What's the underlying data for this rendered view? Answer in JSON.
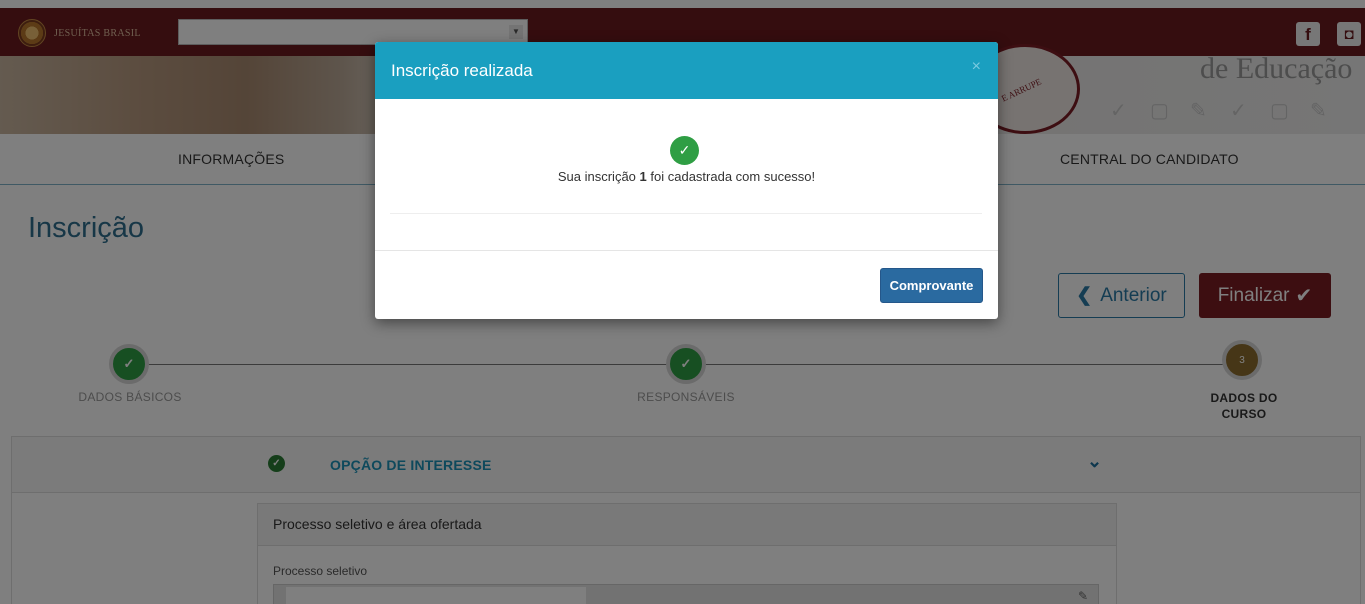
{
  "header": {
    "brand_text": "JESUÍTAS BRASIL",
    "select_value": "",
    "social": [
      "facebook-icon",
      "instagram-icon"
    ],
    "banner_text": "de Educação",
    "seal_text": "E ARRUPE"
  },
  "nav": {
    "items": [
      "INFORMAÇÕES",
      "CENTRAL DO CANDIDATO"
    ]
  },
  "page": {
    "title": "Inscrição",
    "prev_button": "Anterior",
    "finish_button": "Finalizar"
  },
  "stepper": {
    "steps": [
      {
        "label": "DADOS BÁSICOS",
        "state": "done"
      },
      {
        "label": "RESPONSÁVEIS",
        "state": "done"
      },
      {
        "number": "3",
        "label_line1": "DADOS DO",
        "label_line2": "CURSO",
        "state": "current"
      }
    ]
  },
  "section": {
    "title": "OPÇÃO DE INTERESSE",
    "panel_title": "Processo seletivo e área ofertada",
    "field_label": "Processo seletivo",
    "field_value": ""
  },
  "modal": {
    "title": "Inscrição realizada",
    "close": "×",
    "message_prefix": "Sua inscrição",
    "registration_number": "1",
    "message_suffix": "foi cadastrada com sucesso!",
    "button": "Comprovante"
  },
  "colors": {
    "header_bg": "#6b1a1f",
    "modal_header": "#1a9fc0",
    "success": "#2f9e44",
    "finish_button": "#7a1c22",
    "primary_button": "#2a6aa0"
  }
}
